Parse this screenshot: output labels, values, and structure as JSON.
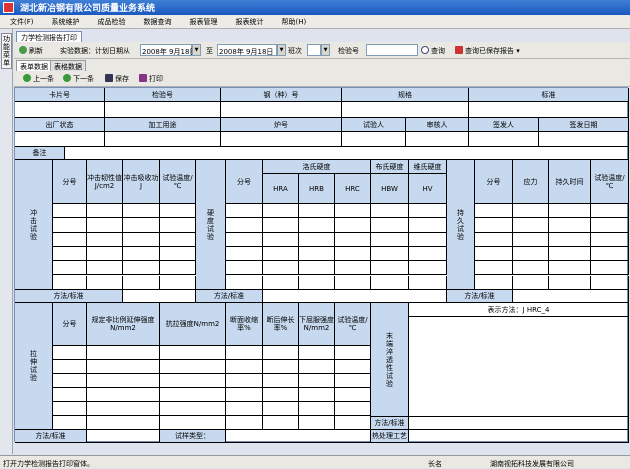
{
  "app": {
    "title": "湖北新冶钢有限公司质量业务系统"
  },
  "menu": [
    "文件(F)",
    "系统维护",
    "成品检验",
    "数据查询",
    "报表管理",
    "报表统计",
    "帮助(H)"
  ],
  "sidebar": {
    "label": "功能菜单"
  },
  "doc_tab": "力学检测报告打印",
  "toolbar": {
    "refresh": "刷新",
    "sample_data": "实验数据：计划日期从",
    "date_from": "2008年 9月18日",
    "to": "至",
    "date_to": "2008年 9月18日",
    "shift": "班次",
    "shift_value": "",
    "test_no": "检验号",
    "test_no_value": "",
    "query": "查询",
    "query_saved": "查询已保存报告"
  },
  "subtabs": [
    "表单数据",
    "表格数据"
  ],
  "nav": {
    "prev": "上一条",
    "next": "下一条",
    "save": "保存",
    "print": "打印"
  },
  "form": {
    "row1": [
      "卡片号",
      "检验号",
      "钢（种）号",
      "规格",
      "标准"
    ],
    "row2": [
      "出厂状态",
      "加工用途",
      "炉号",
      "试验人",
      "审核人",
      "签发人",
      "签发日期"
    ],
    "remark": "备注",
    "impact": {
      "title": "冲击试验",
      "cols": [
        "分号",
        "冲击韧性值J/cm2",
        "冲击吸收功J",
        "试验温度/℃"
      ]
    },
    "hardness": {
      "title": "硬度试验",
      "cols": [
        "分号",
        "洛氏硬度",
        "布氏硬度",
        "维氏硬度"
      ],
      "sub": [
        "HRA",
        "HRB",
        "HRC",
        "HBW",
        "HV"
      ]
    },
    "endurance": {
      "title": "持久试验",
      "cols": [
        "分号",
        "应力",
        "持久时间",
        "试验温度/℃"
      ]
    },
    "method_label": "方法/标准",
    "tensile": {
      "title": "拉伸试验",
      "cols": [
        "分号",
        "规定非比例延伸强度N/mm2",
        "抗拉强度N/mm2",
        "断面收缩率%",
        "断后伸长率%",
        "下屈服强度N/mm2",
        "试验温度/℃"
      ]
    },
    "quench": {
      "title": "末端淬透性试验",
      "display": "表示方法：J HRC_4",
      "method": "方法/标准",
      "process": "热处理工艺"
    },
    "test_type": "试样类型："
  },
  "status": {
    "left": "打开力学检测报告打印窗体。",
    "mid": "长名",
    "right": "湖南视拓科技发展有限公司"
  }
}
